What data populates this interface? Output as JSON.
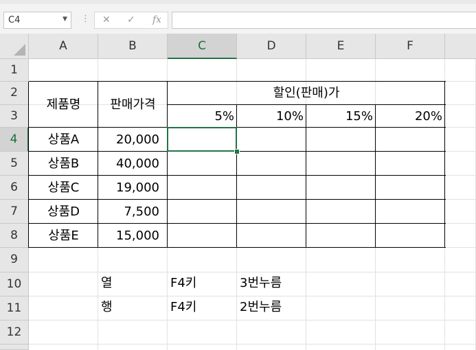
{
  "name_box": {
    "value": "C4"
  },
  "formula_bar": {
    "value": ""
  },
  "columns": [
    "A",
    "B",
    "C",
    "D",
    "E",
    "F"
  ],
  "rows": [
    "1",
    "2",
    "3",
    "4",
    "5",
    "6",
    "7",
    "8",
    "9",
    "10",
    "11",
    "12"
  ],
  "selected_cell": "C4",
  "table": {
    "header_product": "제품명",
    "header_price": "판매가격",
    "header_discount": "할인(판매)가",
    "discount_rates": [
      "5%",
      "10%",
      "15%",
      "20%"
    ],
    "products": [
      {
        "name": "상품A",
        "price": "20,000"
      },
      {
        "name": "상품B",
        "price": "40,000"
      },
      {
        "name": "상품C",
        "price": "19,000"
      },
      {
        "name": "상품D",
        "price": "7,500"
      },
      {
        "name": "상품E",
        "price": "15,000"
      }
    ]
  },
  "notes": [
    {
      "label": "열",
      "key": "F4키",
      "action": "3번누름"
    },
    {
      "label": "행",
      "key": "F4키",
      "action": "2번누름"
    }
  ]
}
